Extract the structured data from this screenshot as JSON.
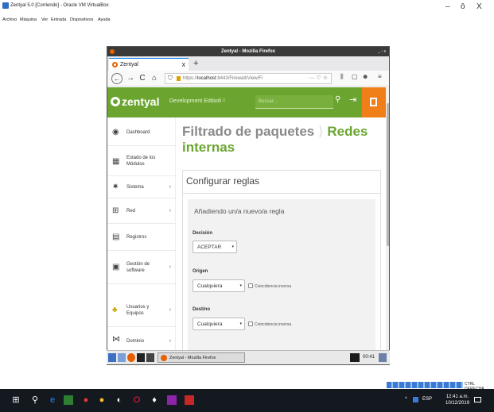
{
  "host": {
    "window_title": "Zentyal 5.0 [Corriendo] - Oracle VM VirtualBox",
    "menu": [
      "Archivo",
      "Máquina",
      "Ver",
      "Entrada",
      "Dispositivos",
      "Ayuda"
    ],
    "controls": {
      "minimize": "–",
      "maximize": "ō",
      "close": "X"
    },
    "status_label": "CTRL DERECHA",
    "taskbar": {
      "language": "ESP",
      "time": "12:41 a.m.",
      "date": "10/12/2019",
      "tray_arrow": "^"
    }
  },
  "firefox": {
    "window_title": "Zentyal - Mozilla Firefox",
    "window_controls": "_ ▫ x",
    "tab": {
      "label": "Zentyal",
      "close": "x"
    },
    "new_tab": "+",
    "nav": {
      "back": "←",
      "forward": "→",
      "reload": "C",
      "home": "⌂"
    },
    "url": {
      "prefix": "https://",
      "host": "localhost",
      "rest": ":8443/Firewall/View/Fi",
      "actions": "··· ♡ ☆"
    },
    "toolbar_right": [
      "⫼",
      "▢",
      "☻",
      "≡"
    ]
  },
  "zentyal": {
    "logo": "zentyal",
    "edition": "Development Edition",
    "version": "5.0",
    "search_placeholder": "Buscar...",
    "page_title": "Filtrado de paquetes",
    "page_title_sep": "⟩",
    "page_subtitle": "Redes internas",
    "panel_title": "Configurar reglas",
    "form_title": "Añadiendo un/a nuevo/a regla",
    "fields": {
      "decision": {
        "label": "Decisión",
        "value": "ACEPTAR"
      },
      "origen": {
        "label": "Origen",
        "value": "Cualquiera",
        "inverse": "Coincidencia inversa"
      },
      "destino": {
        "label": "Destino",
        "value": "Cualquiera",
        "inverse": "Coincidencia inversa"
      }
    },
    "sidebar": [
      {
        "label": "Dashboard",
        "icon": "dashboard-icon",
        "glyph": "◉",
        "chevron": ""
      },
      {
        "label": "Estado de los Módulos",
        "icon": "modules-icon",
        "glyph": "▦",
        "chevron": ""
      },
      {
        "label": "Sistema",
        "icon": "gear-icon",
        "glyph": "✷",
        "chevron": "‹"
      },
      {
        "label": "Red",
        "icon": "network-icon",
        "glyph": "⊞",
        "chevron": "‹"
      },
      {
        "label": "Registros",
        "icon": "document-icon",
        "glyph": "▤",
        "chevron": ""
      },
      {
        "label": "Gestión de software",
        "icon": "package-icon",
        "glyph": "▣",
        "chevron": "‹"
      },
      {
        "label": "Usuarios y Equipos",
        "icon": "users-icon",
        "glyph": "♣",
        "chevron": "‹"
      },
      {
        "label": "Dominio",
        "icon": "domain-icon",
        "glyph": "⋈",
        "chevron": "‹"
      }
    ]
  },
  "guest_taskbar": {
    "window_label": "Zentyal - Mozilla Firefox",
    "clock": "00:41"
  }
}
